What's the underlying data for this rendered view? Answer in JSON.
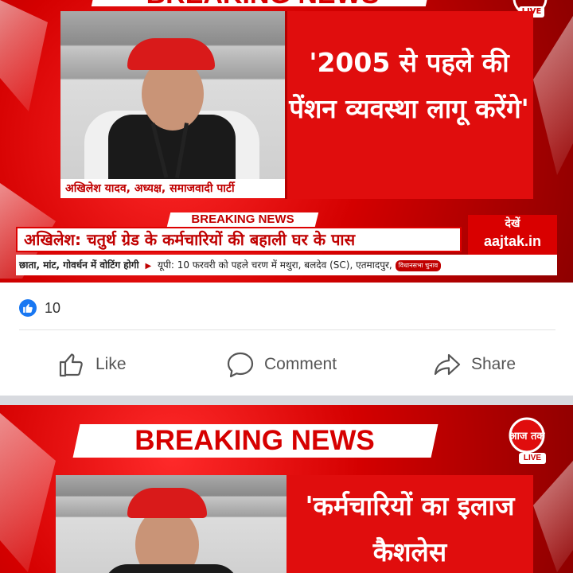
{
  "post1": {
    "image": {
      "top_banner": "BREAKING NEWS",
      "channel_live": "LIVE",
      "quote": "'2005 से पहले की पेंशन व्यवस्था लागू करेंगे'",
      "caption": "अखिलेश यादव, अध्यक्ष, समाजवादी पार्टी",
      "breaking_tab": "BREAKING NEWS",
      "headline": "अखिलेश: चतुर्थ ग्रेड के कर्मचारियों की बहाली घर के पास",
      "dekhen_label": "देखें",
      "dekhen_site": "aajtak.in",
      "ticker_left": "छाता, मांट, गोवर्धन में वोटिंग होगी",
      "ticker_right": "यूपी: 10 फरवरी को पहले चरण में मथुरा, बलदेव (SC), एतमादपुर,",
      "ticker_badge": "विधानसभा चुनाव"
    },
    "reactions": {
      "icon": "like-thumb-icon",
      "count": "10"
    },
    "actions": [
      {
        "label": "Like",
        "icon": "thumbs-up-icon"
      },
      {
        "label": "Comment",
        "icon": "comment-bubble-icon"
      },
      {
        "label": "Share",
        "icon": "share-arrow-icon"
      }
    ]
  },
  "post2": {
    "image": {
      "banner": "BREAKING NEWS",
      "channel_logo": "आज तक",
      "channel_live": "LIVE",
      "quote": "'कर्मचारियों का इलाज कैशलेस"
    }
  },
  "colors": {
    "brand_red": "#d40000",
    "facebook_blue": "#1877f2",
    "action_gray": "#555555"
  }
}
